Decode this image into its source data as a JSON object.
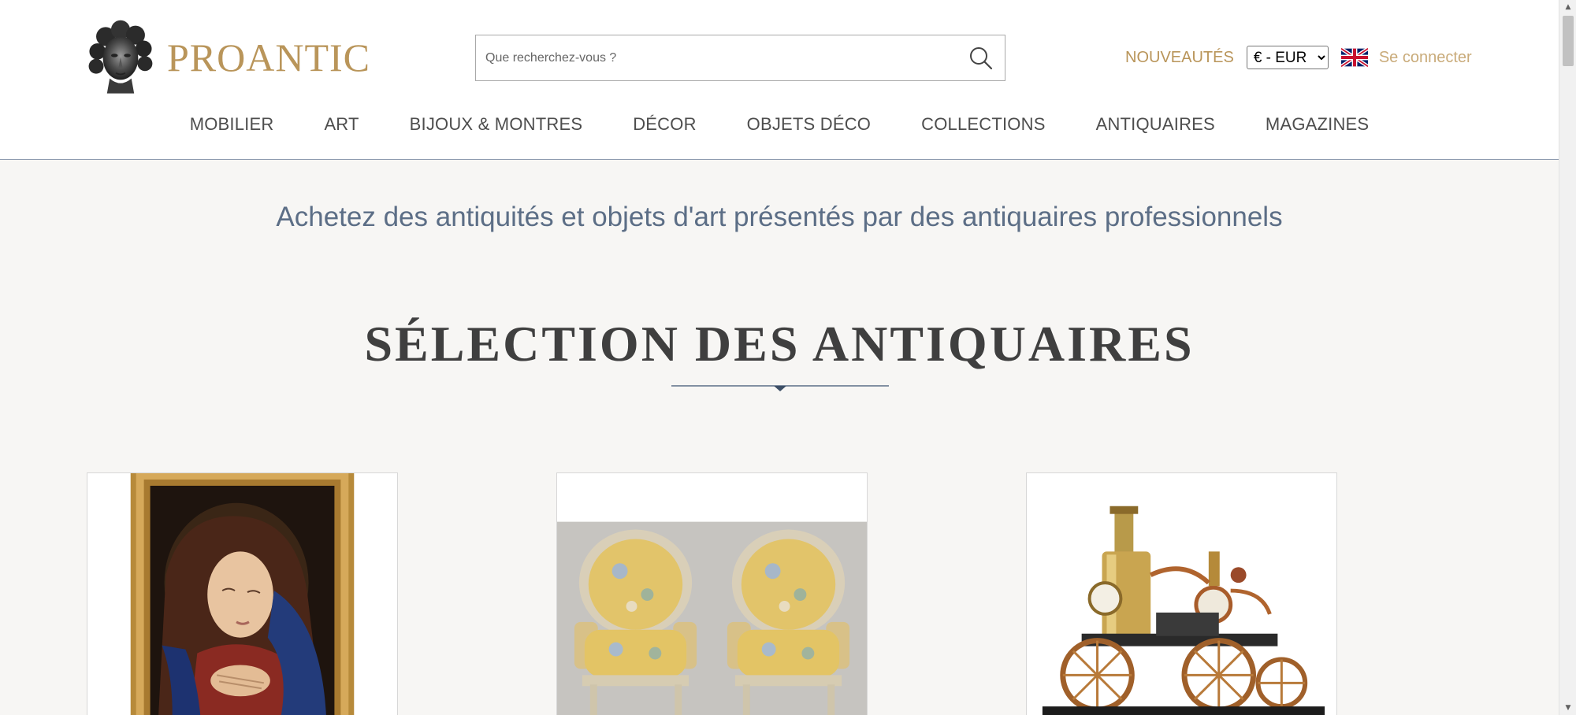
{
  "header": {
    "logo_text": "PROANTIC",
    "search": {
      "placeholder": "Que recherchez-vous ?",
      "value": ""
    },
    "nouveautes_label": "NOUVEAUTÉS",
    "currency": {
      "selected": "€ - EUR"
    },
    "language_icon": "uk-flag-icon",
    "login_label": "Se connecter"
  },
  "nav": {
    "items": [
      {
        "label": "MOBILIER"
      },
      {
        "label": "ART"
      },
      {
        "label": "BIJOUX & MONTRES"
      },
      {
        "label": "DÉCOR"
      },
      {
        "label": "OBJETS DÉCO"
      },
      {
        "label": "COLLECTIONS"
      },
      {
        "label": "ANTIQUAIRES"
      },
      {
        "label": "MAGAZINES"
      }
    ]
  },
  "main": {
    "tagline": "Achetez des antiquités et objets d'art présentés par des antiquaires professionnels",
    "section_title": "SÉLECTION DES ANTIQUAIRES",
    "cards": [
      {
        "image": "madonna-painting"
      },
      {
        "image": "pair-of-armchairs"
      },
      {
        "image": "steam-fire-engine-clock"
      }
    ]
  },
  "colors": {
    "brand_gold": "#b9955a",
    "login_gold": "#c9ab7a",
    "tagline_blue": "#5c6e86",
    "nav_text": "#4d4d4d",
    "page_bg": "#f7f6f4"
  }
}
